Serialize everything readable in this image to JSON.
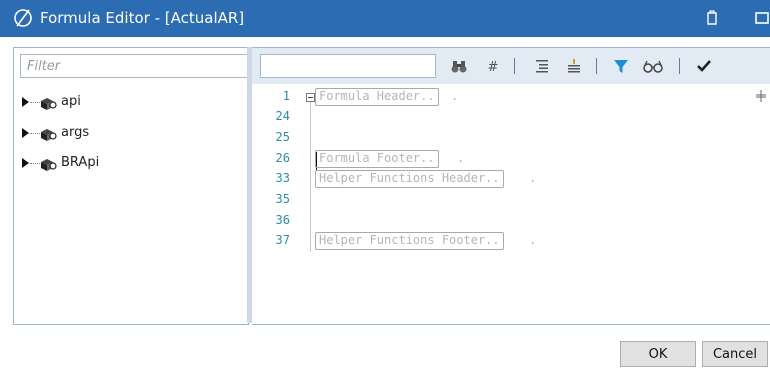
{
  "window": {
    "title": "Formula Editor - [ActualAR]"
  },
  "filter": {
    "placeholder": "Filter"
  },
  "tree": {
    "items": [
      {
        "label": "api"
      },
      {
        "label": "args"
      },
      {
        "label": "BRApi"
      }
    ]
  },
  "toolbar": {
    "search_value": "",
    "icons": [
      "binoculars-icon",
      "hash-icon",
      "indent-icon",
      "outdent-icon",
      "filter-icon",
      "glasses-icon",
      "checkmark-icon"
    ]
  },
  "editor": {
    "lines": [
      {
        "number": "1",
        "text": "Formula Header..",
        "suffix": "."
      },
      {
        "number": "24",
        "text": "",
        "suffix": ""
      },
      {
        "number": "25",
        "text": "",
        "suffix": ""
      },
      {
        "number": "26",
        "text": "Formula Footer..",
        "suffix": "."
      },
      {
        "number": "33",
        "text": "Helper Functions Header..",
        "suffix": "."
      },
      {
        "number": "35",
        "text": "",
        "suffix": ""
      },
      {
        "number": "36",
        "text": "",
        "suffix": ""
      },
      {
        "number": "37",
        "text": "Helper Functions Footer..",
        "suffix": "."
      }
    ]
  },
  "buttons": {
    "ok": "OK",
    "cancel": "Cancel"
  },
  "colors": {
    "titlebar": "#2b6cb3",
    "line_numbers": "#2b8da8",
    "toolbar": "#e2ebf4",
    "filter_icon": "#1a8fd8"
  }
}
